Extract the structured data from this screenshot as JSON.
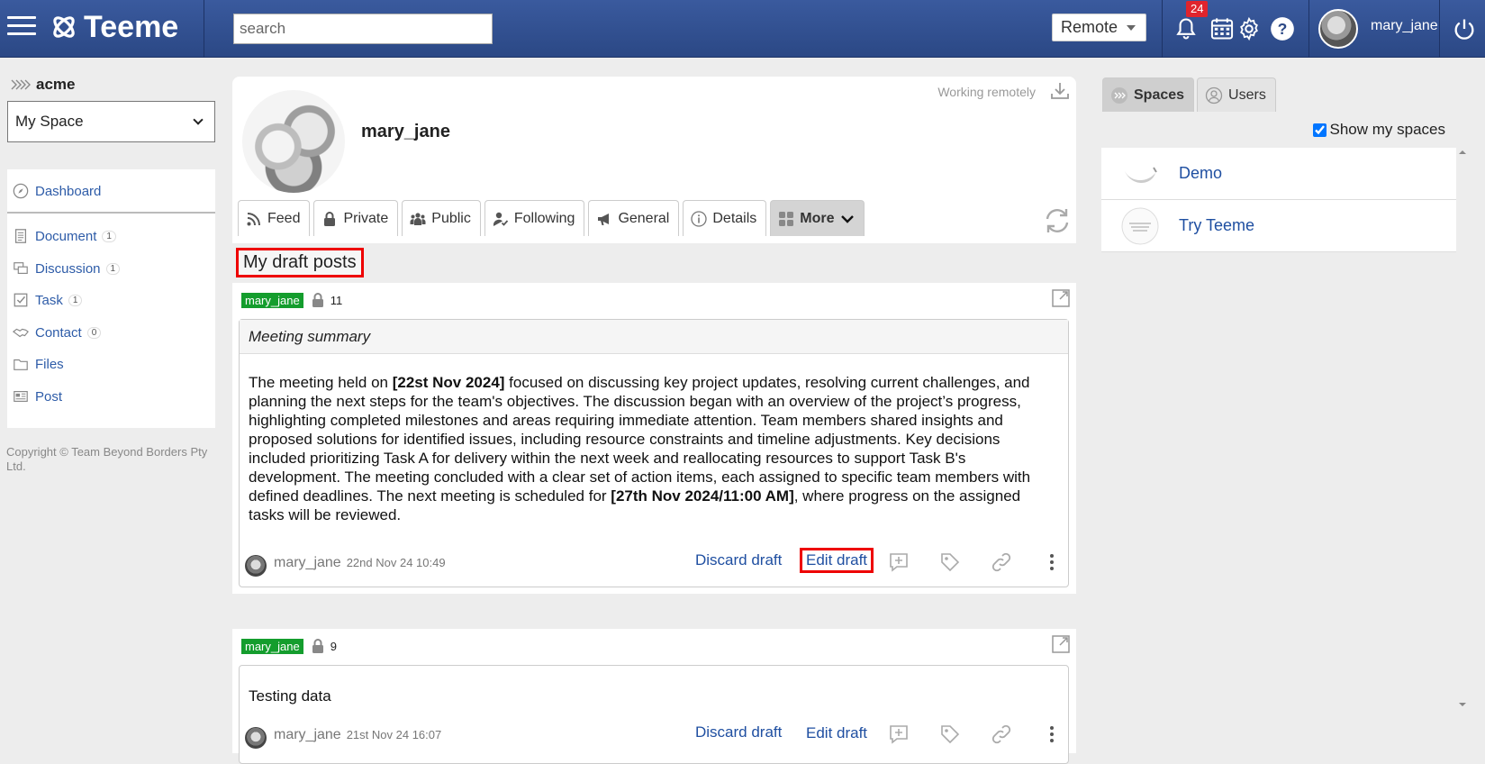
{
  "header": {
    "brand": "Teeme",
    "search_placeholder": "search",
    "mode_select": "Remote",
    "notification_count": "24",
    "username": "mary_jane"
  },
  "sidebar": {
    "org": "acme",
    "space_select": "My Space",
    "nav": [
      {
        "label": "Dashboard",
        "icon": "compass-icon",
        "count": ""
      },
      {
        "label": "Document",
        "icon": "document-icon",
        "count": "1"
      },
      {
        "label": "Discussion",
        "icon": "discussion-icon",
        "count": "1"
      },
      {
        "label": "Task",
        "icon": "checkbox-icon",
        "count": "1"
      },
      {
        "label": "Contact",
        "icon": "handshake-icon",
        "count": "0"
      },
      {
        "label": "Files",
        "icon": "folder-icon",
        "count": ""
      },
      {
        "label": "Post",
        "icon": "post-icon",
        "count": ""
      }
    ],
    "copyright": "Copyright © Team Beyond Borders Pty Ltd."
  },
  "profile": {
    "name": "mary_jane",
    "status": "Working remotely",
    "tabs": [
      {
        "label": "Feed",
        "icon": "rss-icon"
      },
      {
        "label": "Private",
        "icon": "lock-icon"
      },
      {
        "label": "Public",
        "icon": "group-icon"
      },
      {
        "label": "Following",
        "icon": "user-check-icon"
      },
      {
        "label": "General",
        "icon": "megaphone-icon"
      },
      {
        "label": "Details",
        "icon": "info-icon"
      },
      {
        "label": "More",
        "icon": "grid-icon"
      }
    ]
  },
  "section_title": "My draft posts",
  "posts": [
    {
      "user_tag": "mary_jane",
      "post_number": "11",
      "title": "Meeting summary",
      "body_parts": [
        {
          "t": "The meeting held on ",
          "b": false
        },
        {
          "t": "[22st Nov 2024]",
          "b": true
        },
        {
          "t": " focused on discussing key project updates, resolving current challenges, and planning the next steps for the team's objectives. The discussion began with an overview of the project’s progress, highlighting completed milestones and areas requiring immediate attention. Team members shared insights and proposed solutions for identified issues, including resource constraints and timeline adjustments. Key decisions included prioritizing Task A for delivery within the next week and reallocating resources to support Task B's development. The meeting concluded with a clear set of action items, each assigned to specific team members with defined deadlines. The next meeting is scheduled for ",
          "b": false
        },
        {
          "t": "[27th Nov 2024/11:00 AM]",
          "b": true
        },
        {
          "t": ", where progress on the assigned tasks will be reviewed.",
          "b": false
        }
      ],
      "author": "mary_jane",
      "date": "22nd Nov 24 10:49",
      "discard_label": "Discard draft",
      "edit_label": "Edit draft"
    },
    {
      "user_tag": "mary_jane",
      "post_number": "9",
      "title": "",
      "body_text": "Testing data",
      "author": "mary_jane",
      "date": "21st Nov 24 16:07",
      "discard_label": "Discard draft",
      "edit_label": "Edit draft"
    }
  ],
  "right_panel": {
    "tabs": [
      {
        "label": "Spaces",
        "active": true
      },
      {
        "label": "Users",
        "active": false
      }
    ],
    "show_my_spaces_label": "Show my spaces",
    "show_my_spaces_checked": true,
    "spaces": [
      {
        "name": "Demo"
      },
      {
        "name": "Try Teeme"
      }
    ]
  },
  "colors": {
    "topbar": "#2b4885",
    "link": "#1f4fa1",
    "user_tag": "#149d2d",
    "badge": "#e0242d",
    "highlight": "#ee0000"
  }
}
